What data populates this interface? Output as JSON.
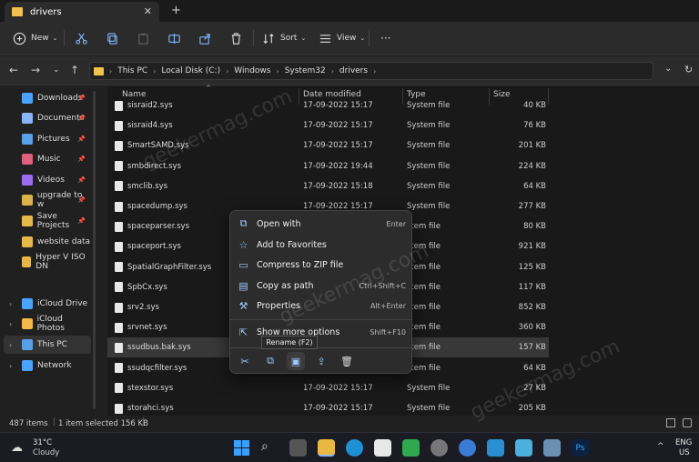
{
  "tab": {
    "title": "drivers",
    "close": "✕",
    "new": "+"
  },
  "toolbar": {
    "new_label": "New",
    "sort_label": "Sort",
    "view_label": "View",
    "more": "···"
  },
  "address": {
    "crumbs": [
      "This PC",
      "Local Disk (C:)",
      "Windows",
      "System32",
      "drivers"
    ]
  },
  "sidebar": {
    "quick": [
      {
        "label": "Downloads",
        "color": "#4aa3ff"
      },
      {
        "label": "Documents",
        "color": "#8ab4f8"
      },
      {
        "label": "Pictures",
        "color": "#5aa0e6"
      },
      {
        "label": "Music",
        "color": "#e0607e"
      },
      {
        "label": "Videos",
        "color": "#9b6cf0"
      },
      {
        "label": "upgrade to w",
        "color": "#d9b24a"
      },
      {
        "label": "Save Projects",
        "color": "#e6b84a"
      },
      {
        "label": "website data",
        "color": "#e6b84a"
      },
      {
        "label": "Hyper V ISO DN",
        "color": "#e6b84a"
      }
    ],
    "tree": [
      {
        "label": "iCloud Drive",
        "color": "#4aa3ff"
      },
      {
        "label": "iCloud Photos",
        "color": "#f2b84a"
      },
      {
        "label": "This PC",
        "color": "#5aa0e6"
      },
      {
        "label": "Network",
        "color": "#4aa3ff"
      }
    ]
  },
  "columns": {
    "name": "Name",
    "date": "Date modified",
    "type": "Type",
    "size": "Size"
  },
  "files": [
    {
      "name": "sisraid2.sys",
      "date": "17-09-2022 15:17",
      "type": "System file",
      "size": "40 KB"
    },
    {
      "name": "sisraid4.sys",
      "date": "17-09-2022 15:17",
      "type": "System file",
      "size": "76 KB"
    },
    {
      "name": "SmartSAMD.sys",
      "date": "17-09-2022 15:17",
      "type": "System file",
      "size": "201 KB"
    },
    {
      "name": "smbdirect.sys",
      "date": "17-09-2022 19:44",
      "type": "System file",
      "size": "224 KB"
    },
    {
      "name": "smclib.sys",
      "date": "17-09-2022 15:18",
      "type": "System file",
      "size": "64 KB"
    },
    {
      "name": "spacedump.sys",
      "date": "17-09-2022 15:17",
      "type": "System file",
      "size": "277 KB"
    },
    {
      "name": "spaceparser.sys",
      "date": "",
      "type": "stem file",
      "size": "80 KB"
    },
    {
      "name": "spaceport.sys",
      "date": "",
      "type": "stem file",
      "size": "921 KB"
    },
    {
      "name": "SpatialGraphFilter.sys",
      "date": "",
      "type": "stem file",
      "size": "125 KB"
    },
    {
      "name": "SpbCx.sys",
      "date": "",
      "type": "stem file",
      "size": "117 KB"
    },
    {
      "name": "srv2.sys",
      "date": "",
      "type": "stem file",
      "size": "852 KB"
    },
    {
      "name": "srvnet.sys",
      "date": "",
      "type": "stem file",
      "size": "360 KB"
    },
    {
      "name": "ssudbus.bak.sys",
      "date": "",
      "type": "stem file",
      "size": "157 KB"
    },
    {
      "name": "ssudqcfilter.sys",
      "date": "",
      "type": "stem file",
      "size": "64 KB"
    },
    {
      "name": "stexstor.sys",
      "date": "17-09-2022 15:17",
      "type": "System file",
      "size": "27 KB"
    },
    {
      "name": "storahci.sys",
      "date": "17-09-2022 15:17",
      "type": "System file",
      "size": "205 KB"
    }
  ],
  "context_menu": {
    "items": [
      {
        "label": "Open with",
        "shortcut": "Enter"
      },
      {
        "label": "Add to Favorites",
        "shortcut": ""
      },
      {
        "label": "Compress to ZIP file",
        "shortcut": ""
      },
      {
        "label": "Copy as path",
        "shortcut": "Ctrl+Shift+C"
      },
      {
        "label": "Properties",
        "shortcut": "Alt+Enter"
      },
      {
        "label": "Show more options",
        "shortcut": "Shift+F10"
      }
    ],
    "tooltip": "Rename (F2)"
  },
  "status": {
    "items": "487 items",
    "selected": "1 item selected  156 KB"
  },
  "taskbar": {
    "temp": "31°C",
    "weather": "Cloudy",
    "lang": "ENG",
    "region": "US",
    "chevron": "^"
  },
  "watermark": "geekermag.com"
}
